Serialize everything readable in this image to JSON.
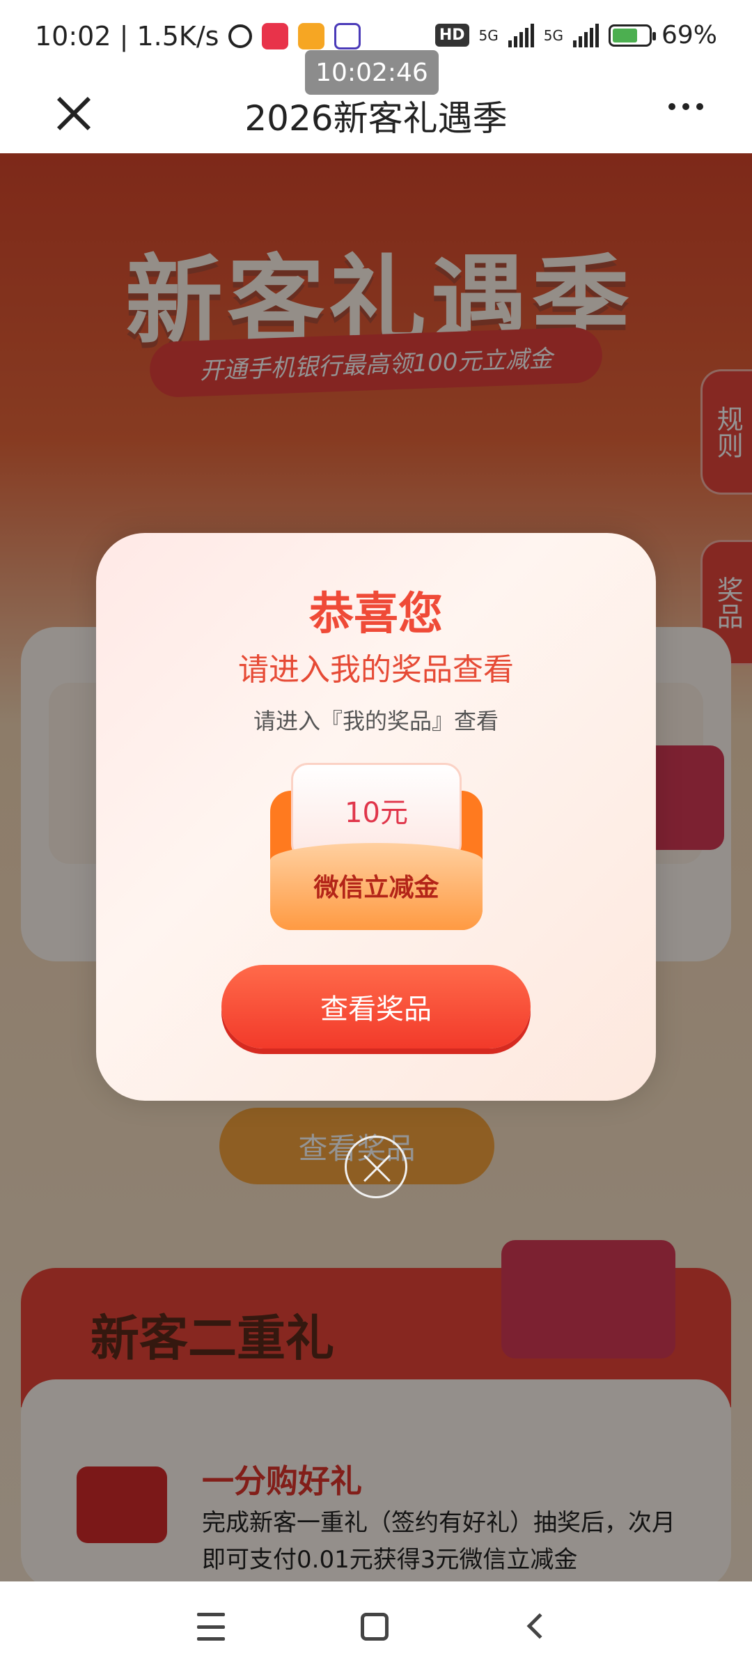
{
  "statusbar": {
    "time_speed": "10:02 | 1.5K/s",
    "hd": "HD",
    "net1": "5G",
    "net2": "5G",
    "battery": "69%"
  },
  "time_overlay": "10:02:46",
  "navbar": {
    "title": "2026新客礼遇季"
  },
  "page": {
    "hero_title": "新客礼遇季",
    "hero_ribbon": "开通手机银行最高领100元立减金",
    "side_tab_rules": "规则",
    "side_tab_prizes": "奖品",
    "bg_view_button": "查看奖品",
    "section2_title": "新客二重礼",
    "section2_heading": "一分购好礼",
    "section2_desc": "完成新客一重礼（签约有好礼）抽奖后，次月即可支付0.01元获得3元微信立减金"
  },
  "modal": {
    "title": "恭喜您",
    "subtitle": "请进入我的奖品查看",
    "hint": "请进入『我的奖品』查看",
    "prize_value": "10元",
    "prize_label": "微信立减金",
    "button": "查看奖品"
  },
  "colors": {
    "accent": "#ef4a37",
    "button": "#f23a2a"
  }
}
